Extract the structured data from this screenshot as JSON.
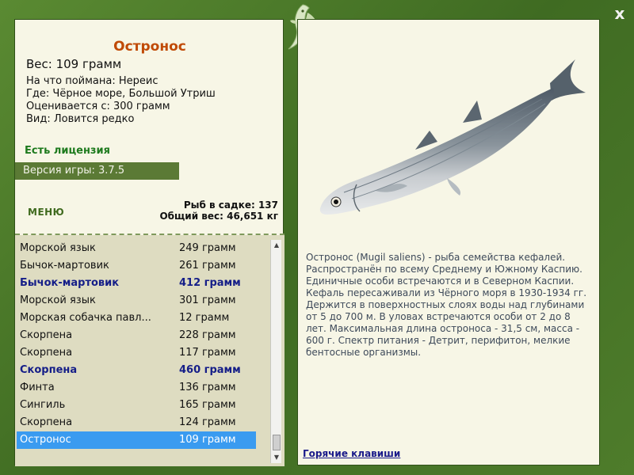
{
  "fish": {
    "title": "Остронос",
    "weight": "Вес: 109 грамм",
    "caught_on": "На что поймана: Нереис",
    "where": "Где: Чёрное море, Большой Утриш",
    "valued": "Оценивается с: 300 грамм",
    "kind": "Вид: Ловится редко"
  },
  "license": "Есть лицензия",
  "version": "Версия игры: 3.7.5",
  "menu_label": "МЕНЮ",
  "stats": {
    "in_cage": "Рыб в садке: 137",
    "total_weight": "Общий вес: 46,651 кг"
  },
  "catch_list": [
    {
      "name": "Морской язык",
      "weight": "249 грамм",
      "bold": false,
      "selected": false
    },
    {
      "name": "Бычок-мартовик",
      "weight": "261 грамм",
      "bold": false,
      "selected": false
    },
    {
      "name": "Бычок-мартовик",
      "weight": "412 грамм",
      "bold": true,
      "selected": false
    },
    {
      "name": "Морской язык",
      "weight": "301 грамм",
      "bold": false,
      "selected": false
    },
    {
      "name": "Морская собачка павл...",
      "weight": "12 грамм",
      "bold": false,
      "selected": false
    },
    {
      "name": "Скорпена",
      "weight": "228 грамм",
      "bold": false,
      "selected": false
    },
    {
      "name": "Скорпена",
      "weight": "117 грамм",
      "bold": false,
      "selected": false
    },
    {
      "name": "Скорпена",
      "weight": "460 грамм",
      "bold": true,
      "selected": false
    },
    {
      "name": "Финта",
      "weight": "136 грамм",
      "bold": false,
      "selected": false
    },
    {
      "name": "Сингиль",
      "weight": "165 грамм",
      "bold": false,
      "selected": false
    },
    {
      "name": "Скорпена",
      "weight": "124 грамм",
      "bold": false,
      "selected": false
    },
    {
      "name": "Остронос",
      "weight": "109 грамм",
      "bold": false,
      "selected": true
    }
  ],
  "description": "Остронос (Mugil saliens) - рыба семейства кефалей. Распространён по всему Среднему и Южному Каспию. Единичные особи встречаются и в Северном Каспии. Кефаль пересаживали из Чёрного моря в 1930-1934 гг. Держится в поверхностных слоях воды над глубинами от 5 до 700 м. В уловах встречаются особи от 2 до 8 лет. Максимальная длина остроноса - 31,5 см, масса - 600 г. Спектр питания - Детрит, перифитон, мелкие бентосные организмы.",
  "hotkeys_link": "Горячие клавиши",
  "close_symbol": "x",
  "colors": {
    "title": "#c04a06",
    "license": "#1d7a1d",
    "selection": "#3a9bf0",
    "highlight_row": "#151e88"
  },
  "icons": {
    "close": "close-icon",
    "logo": "fish-logo-icon",
    "scroll_up": "scroll-up-arrow-icon",
    "scroll_down": "scroll-down-arrow-icon"
  }
}
